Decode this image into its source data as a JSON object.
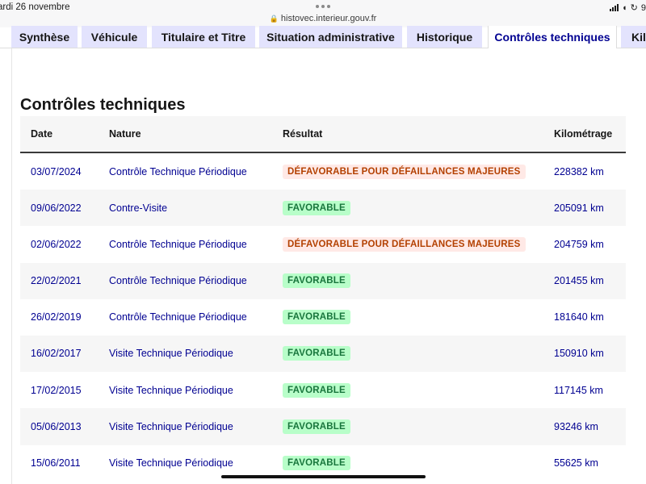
{
  "statusbar": {
    "date": "ardi 26 novembre",
    "url": "histovec.interieur.gouv.fr",
    "battery_text": "9"
  },
  "tabs": [
    {
      "label": "Synthèse",
      "active": false
    },
    {
      "label": "Véhicule",
      "active": false
    },
    {
      "label": "Titulaire et Titre",
      "active": false
    },
    {
      "label": "Situation administrative",
      "active": false
    },
    {
      "label": "Historique",
      "active": false
    },
    {
      "label": "Contrôles techniques",
      "active": true
    },
    {
      "label": "Kilo",
      "active": false
    }
  ],
  "section": {
    "title": "Contrôles techniques"
  },
  "table": {
    "headers": {
      "date": "Date",
      "nature": "Nature",
      "result": "Résultat",
      "km": "Kilométrage"
    },
    "rows": [
      {
        "date": "03/07/2024",
        "nature": "Contrôle Technique Périodique",
        "result": "DÉFAVORABLE POUR DÉFAILLANCES MAJEURES",
        "status": "ko",
        "km": "228382 km"
      },
      {
        "date": "09/06/2022",
        "nature": "Contre-Visite",
        "result": "FAVORABLE",
        "status": "ok",
        "km": "205091 km"
      },
      {
        "date": "02/06/2022",
        "nature": "Contrôle Technique Périodique",
        "result": "DÉFAVORABLE POUR DÉFAILLANCES MAJEURES",
        "status": "ko",
        "km": "204759 km"
      },
      {
        "date": "22/02/2021",
        "nature": "Contrôle Technique Périodique",
        "result": "FAVORABLE",
        "status": "ok",
        "km": "201455 km"
      },
      {
        "date": "26/02/2019",
        "nature": "Contrôle Technique Périodique",
        "result": "FAVORABLE",
        "status": "ok",
        "km": "181640 km"
      },
      {
        "date": "16/02/2017",
        "nature": "Visite Technique Périodique",
        "result": "FAVORABLE",
        "status": "ok",
        "km": "150910 km"
      },
      {
        "date": "17/02/2015",
        "nature": "Visite Technique Périodique",
        "result": "FAVORABLE",
        "status": "ok",
        "km": "117145 km"
      },
      {
        "date": "05/06/2013",
        "nature": "Visite Technique Périodique",
        "result": "FAVORABLE",
        "status": "ok",
        "km": "93246 km"
      },
      {
        "date": "15/06/2011",
        "nature": "Visite Technique Périodique",
        "result": "FAVORABLE",
        "status": "ok",
        "km": "55625 km"
      }
    ]
  },
  "colors": {
    "accent": "#000091",
    "tab_inactive_bg": "#e3e3fd",
    "favorable_bg": "#b8fec9",
    "favorable_text": "#18753c",
    "defavorable_bg": "#ffe9e6",
    "defavorable_text": "#b34000"
  },
  "icons": [
    "lock-icon",
    "wifi-icon",
    "signal-icon",
    "rotation-lock-icon"
  ]
}
